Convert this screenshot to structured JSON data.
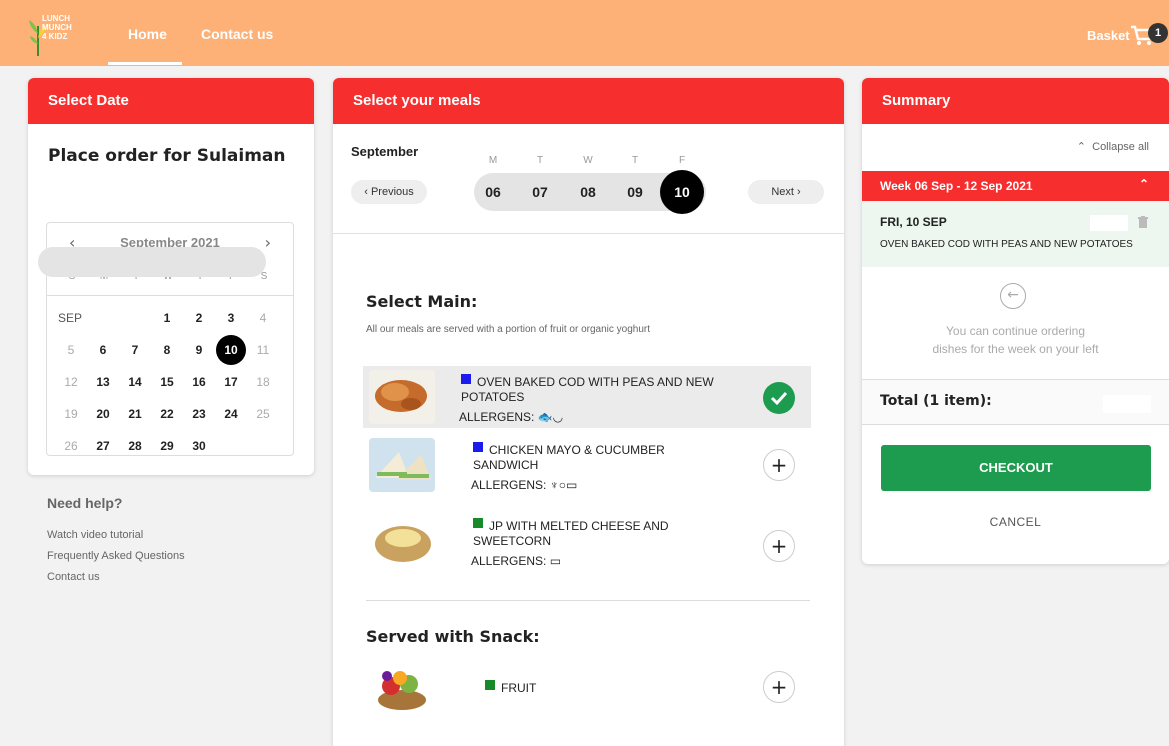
{
  "header": {
    "logo_lines": [
      "LUNCH",
      "MUNCH",
      "4 KIDZ"
    ],
    "nav": [
      {
        "label": "Home"
      },
      {
        "label": "Contact us"
      }
    ],
    "basket_label": "Basket",
    "basket_count": "1",
    "bg_color": "#fdb177"
  },
  "select_date": {
    "heading": "Select Date",
    "order_title": "Place order for Sulaiman",
    "calendar": {
      "title": "September 2021",
      "prev_icon": "‹",
      "next_icon": "›",
      "dow": [
        "S",
        "M",
        "T",
        "W",
        "T",
        "F",
        "S"
      ],
      "month_label": "SEP",
      "rows": [
        [
          "",
          "",
          "",
          "1",
          "2",
          "3",
          "4"
        ],
        [
          "5",
          "6",
          "7",
          "8",
          "9",
          "10",
          "11"
        ],
        [
          "12",
          "13",
          "14",
          "15",
          "16",
          "17",
          "18"
        ],
        [
          "19",
          "20",
          "21",
          "22",
          "23",
          "24",
          "25"
        ],
        [
          "26",
          "27",
          "28",
          "29",
          "30",
          "",
          ""
        ]
      ],
      "selected": "10"
    }
  },
  "help": {
    "title": "Need help?",
    "links": [
      "Watch video tutorial",
      "Frequently Asked Questions",
      "Contact us"
    ]
  },
  "meals_panel": {
    "heading": "Select your meals",
    "month": "September",
    "prev_label": "Previous",
    "next_label": "Next",
    "day_letters": [
      "M",
      "T",
      "W",
      "T",
      "F"
    ],
    "days": [
      "06",
      "07",
      "08",
      "09",
      "10"
    ],
    "selected_day": "10",
    "main_title": "Select Main:",
    "main_sub": "All our meals are served with a portion of fruit or organic yoghurt",
    "meals": [
      {
        "name": "OVEN BAKED COD WITH PEAS AND NEW POTATOES",
        "allergens_label": "ALLERGENS:",
        "dot_color": "#1b1bf0",
        "selected": true
      },
      {
        "name": "CHICKEN MAYO & CUCUMBER SANDWICH",
        "allergens_label": "ALLERGENS:",
        "dot_color": "#1b1bf0",
        "selected": false
      },
      {
        "name": "JP WITH MELTED CHEESE AND SWEETCORN",
        "allergens_label": "ALLERGENS:",
        "dot_color": "#178a2a",
        "selected": false
      }
    ],
    "snack_title": "Served with Snack:",
    "snack": {
      "name": "FRUIT",
      "dot_color": "#178a2a"
    },
    "add_icon": "+"
  },
  "summary": {
    "heading": "Summary",
    "collapse_label": "Collapse all",
    "week_label": "Week 06 Sep - 12 Sep 2021",
    "item_date": "FRI, 10 SEP",
    "item_meal": "OVEN BAKED COD WITH PEAS AND NEW POTATOES",
    "continue_line1": "You can continue ordering",
    "continue_line2": "dishes for the week on your left",
    "total_label": "Total (1 item):",
    "checkout_label": "CHECKOUT",
    "cancel_label": "CANCEL",
    "checkout_color": "#1d9b4e",
    "accent_color": "#f72e2e"
  }
}
